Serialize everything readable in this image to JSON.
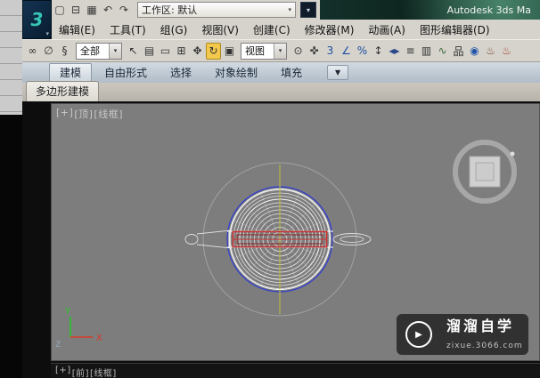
{
  "window": {
    "title": "Autodesk 3ds Ma",
    "logo_glyph": "3",
    "logo_caret": "▾"
  },
  "workspace": {
    "label": "工作区: 默认",
    "caret": "▾"
  },
  "quick_access": {
    "icons": [
      {
        "name": "new-scene-icon",
        "glyph": "▢"
      },
      {
        "name": "open-file-icon",
        "glyph": "⊟"
      },
      {
        "name": "save-file-icon",
        "glyph": "▦"
      },
      {
        "name": "undo-icon",
        "glyph": "↶"
      },
      {
        "name": "redo-icon",
        "glyph": "↷"
      }
    ]
  },
  "menu": {
    "items": [
      {
        "name": "menu-edit",
        "label": "编辑(E)"
      },
      {
        "name": "menu-tools",
        "label": "工具(T)"
      },
      {
        "name": "menu-group",
        "label": "组(G)"
      },
      {
        "name": "menu-views",
        "label": "视图(V)"
      },
      {
        "name": "menu-create",
        "label": "创建(C)"
      },
      {
        "name": "menu-modifiers",
        "label": "修改器(M)"
      },
      {
        "name": "menu-animation",
        "label": "动画(A)"
      },
      {
        "name": "menu-graph-editors",
        "label": "图形编辑器(D)"
      }
    ]
  },
  "toolbar": {
    "group_a": [
      {
        "name": "select-and-link-icon",
        "glyph": "∞"
      },
      {
        "name": "unlink-selection-icon",
        "glyph": "∅"
      },
      {
        "name": "bind-to-space-warp-icon",
        "glyph": "§"
      }
    ],
    "filter_combo": {
      "value": "全部",
      "caret": "▾"
    },
    "group_b": [
      {
        "name": "select-object-icon",
        "glyph": "↖"
      },
      {
        "name": "select-by-name-icon",
        "glyph": "▤"
      },
      {
        "name": "rect-selection-region-icon",
        "glyph": "▭"
      },
      {
        "name": "window-crossing-icon",
        "glyph": "⊞"
      },
      {
        "name": "select-and-move-icon",
        "glyph": "✥"
      },
      {
        "name": "select-and-rotate-icon",
        "glyph": "↻",
        "active": true
      },
      {
        "name": "select-and-scale-icon",
        "glyph": "▣"
      }
    ],
    "coord_combo": {
      "value": "视图",
      "caret": "▾"
    },
    "group_c": [
      {
        "name": "use-pivot-center-icon",
        "glyph": "⊙"
      },
      {
        "name": "select-and-manipulate-icon",
        "glyph": "✜"
      },
      {
        "name": "snap-toggle-3d-icon",
        "glyph": "3",
        "color": "#1c4f9e"
      },
      {
        "name": "angle-snap-icon",
        "glyph": "∠",
        "color": "#1c4f9e"
      },
      {
        "name": "percent-snap-icon",
        "glyph": "%",
        "color": "#1c4f9e"
      },
      {
        "name": "spinner-snap-icon",
        "glyph": "↕"
      },
      {
        "name": "mirror-icon",
        "glyph": "◂▸",
        "color": "#2a4a8a"
      },
      {
        "name": "align-icon",
        "glyph": "≡"
      },
      {
        "name": "layer-manager-icon",
        "glyph": "▥"
      },
      {
        "name": "curve-editor-icon",
        "glyph": "∿",
        "color": "#3a6a3a"
      },
      {
        "name": "schematic-view-icon",
        "glyph": "品"
      },
      {
        "name": "material-editor-icon",
        "glyph": "◉",
        "color": "#2255aa"
      },
      {
        "name": "render-setup-icon",
        "glyph": "♨",
        "color": "#7a4a2a"
      },
      {
        "name": "render-production-icon",
        "glyph": "♨",
        "color": "#aa3a2a"
      }
    ]
  },
  "ribbon": {
    "tabs": [
      {
        "name": "tab-modeling",
        "label": "建模",
        "active": true
      },
      {
        "name": "tab-freeform",
        "label": "自由形式"
      },
      {
        "name": "tab-selection",
        "label": "选择"
      },
      {
        "name": "tab-object-paint",
        "label": "对象绘制"
      },
      {
        "name": "tab-populate",
        "label": "填充"
      }
    ],
    "caret": "▼",
    "subtab": "多边形建模"
  },
  "viewport": {
    "label_plus": "[+]",
    "label_view": "[顶]",
    "label_shading": "[线框]",
    "axis_x": "X",
    "axis_y": "Y",
    "axis_z": "Z",
    "bottom_label_plus": "[+]",
    "bottom_label_view": "[前]",
    "bottom_label_shading": "[线框]"
  },
  "watermark": {
    "play_glyph": "▶",
    "title": "溜溜自学",
    "url": "zixue.3066.com"
  },
  "colors": {
    "viewport_bg": "#7d7d7d",
    "selection_red": "#c83232",
    "wire_blue": "#2e3bd6",
    "axis_green": "#22cc22",
    "axis_red": "#dd3a28"
  }
}
